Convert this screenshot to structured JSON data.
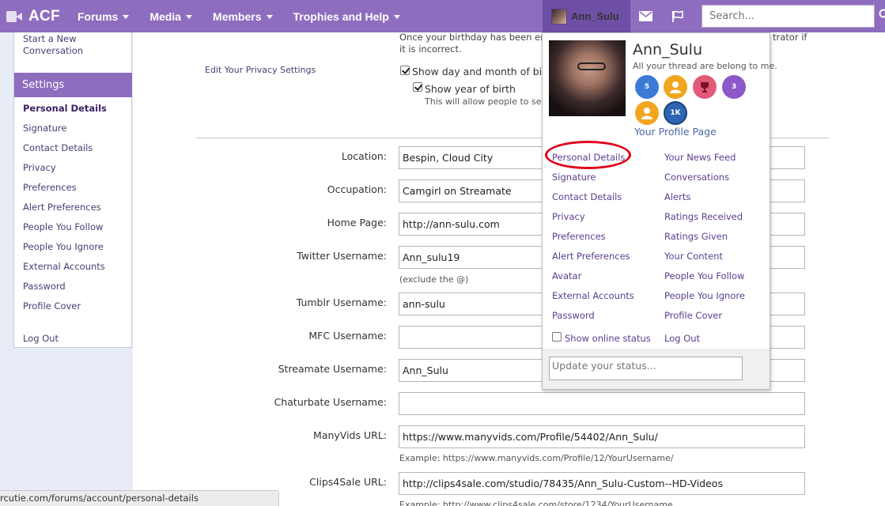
{
  "topbar": {
    "logo": "ACF",
    "tabs": [
      {
        "label": "Forums"
      },
      {
        "label": "Media"
      },
      {
        "label": "Members"
      },
      {
        "label": "Trophies and Help"
      }
    ],
    "user": "Ann_Sulu",
    "search_placeholder": "Search...",
    "accent": "#8e6dbf"
  },
  "sidebar": {
    "start_conversation": "Start a New Conversation",
    "settings_header": "Settings",
    "items": [
      "Personal Details",
      "Signature",
      "Contact Details",
      "Privacy",
      "Preferences",
      "Alert Preferences",
      "People You Follow",
      "People You Ignore",
      "External Accounts",
      "Password",
      "Profile Cover"
    ],
    "logout": "Log Out"
  },
  "privacy": {
    "birthday_note_1": "Once your birthday has been ente",
    "birthday_note_1b": "trator if",
    "birthday_note_2": "it is incorrect.",
    "edit_privacy": "Edit Your Privacy Settings",
    "show_day_month": "Show day and month of birt",
    "show_year": "Show year of birth",
    "show_year_note": "This will allow people to see y"
  },
  "form": {
    "fields": [
      {
        "label": "Location:",
        "value": "Bespin, Cloud City"
      },
      {
        "label": "Occupation:",
        "value": "Camgirl on Streamate"
      },
      {
        "label": "Home Page:",
        "value": "http://ann-sulu.com"
      },
      {
        "label": "Twitter Username:",
        "value": "Ann_sulu19",
        "hint": "(exclude the @)"
      },
      {
        "label": "Tumblr Username:",
        "value": "ann-sulu"
      },
      {
        "label": "MFC Username:",
        "value": ""
      },
      {
        "label": "Streamate Username:",
        "value": "Ann_Sulu"
      },
      {
        "label": "Chaturbate Username:",
        "value": ""
      },
      {
        "label": "ManyVids URL:",
        "value": "https://www.manyvids.com/Profile/54402/Ann_Sulu/",
        "hint": "Example: https://www.manyvids.com/Profile/12/YourUsername/"
      },
      {
        "label": "Clips4Sale URL:",
        "value": "http://clips4sale.com/studio/78435/Ann_Sulu-Custom--HD-Videos",
        "hint": "Example: http://www.clips4sale.com/store/1234/YourUsername"
      }
    ]
  },
  "dropdown": {
    "username": "Ann_Sulu",
    "tagline": "All your thread are belong to me.",
    "trophies": [
      {
        "icon": "trophy-5-icon",
        "text": "5",
        "color": "#3b7bd6"
      },
      {
        "icon": "trophy-person-icon",
        "text": "",
        "color": "#f2a51e"
      },
      {
        "icon": "trophy-cup-icon",
        "text": "",
        "color": "#e25a78"
      },
      {
        "icon": "trophy-3-icon",
        "text": "3",
        "color": "#8b57c9"
      },
      {
        "icon": "trophy-person2-icon",
        "text": "",
        "color": "#f2a51e"
      },
      {
        "icon": "trophy-1k-icon",
        "text": "1K",
        "color": "#2f64b3"
      }
    ],
    "profile_link": "Your Profile Page",
    "left_links": [
      "Personal Details",
      "Signature",
      "Contact Details",
      "Privacy",
      "Preferences",
      "Alert Preferences",
      "Avatar",
      "External Accounts",
      "Password"
    ],
    "right_links": [
      "Your News Feed",
      "Conversations",
      "Alerts",
      "Ratings Received",
      "Ratings Given",
      "Your Content",
      "People You Follow",
      "People You Ignore",
      "Profile Cover"
    ],
    "show_online": "Show online status",
    "logout": "Log Out",
    "status_placeholder": "Update your status..."
  },
  "statusbar": {
    "url": "rcutie.com/forums/account/personal-details"
  }
}
